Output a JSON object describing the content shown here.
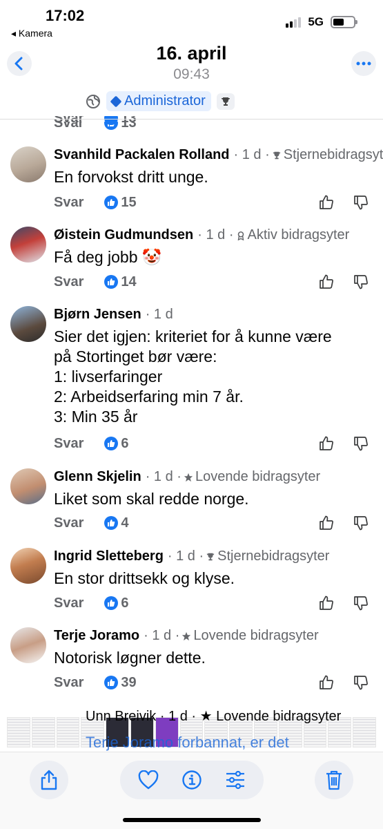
{
  "status_bar": {
    "time": "17:02",
    "back_app": "◂ Kamera",
    "network": "5G"
  },
  "header": {
    "date": "16. april",
    "time": "09:43"
  },
  "badges": {
    "admin_label": "Administrator"
  },
  "top_partial": {
    "reply": "Svar",
    "likes": "13"
  },
  "comments": [
    {
      "name": "Svanhild Packalen Rolland",
      "age": "· 1 d ·",
      "badge": "Stjernebidragsyter",
      "text": "En forvokst dritt unge.",
      "reply": "Svar",
      "likes": "15"
    },
    {
      "name": "Øistein Gudmundsen",
      "age": "· 1 d ·",
      "badge": "Aktiv bidragsyter",
      "text": "Få deg jobb 🤡",
      "reply": "Svar",
      "likes": "14"
    },
    {
      "name": "Bjørn Jensen",
      "age": "· 1 d",
      "badge": "",
      "text_lines": [
        "Sier det igjen: kriteriet for å kunne være",
        "på Stortinget bør være:",
        "1: livserfaringer",
        "2: Arbeidserfaring min 7 år.",
        "3: Min 35 år"
      ],
      "reply": "Svar",
      "likes": "6"
    },
    {
      "name": "Glenn Skjelin",
      "age": "· 1 d ·",
      "badge": "Lovende bidragsyter",
      "text": "Liket som skal redde norge.",
      "reply": "Svar",
      "likes": "4"
    },
    {
      "name": "Ingrid Sletteberg",
      "age": "· 1 d ·",
      "badge": "Stjernebidragsyter",
      "text": "En stor drittsekk og klyse.",
      "reply": "Svar",
      "likes": "6"
    },
    {
      "name": "Terje Joramo",
      "age": "· 1 d ·",
      "badge": "Lovende bidragsyter",
      "text": "Notorisk løgner dette.",
      "reply": "Svar",
      "likes": "39"
    }
  ],
  "bottom_partial": {
    "header": "Unn Breivik · 1 d · ★ Lovende bidragsyter",
    "text": "Terje Joramo forbannat, er det"
  },
  "colors": {
    "accent": "#1877f2",
    "meta": "#65676b",
    "admin_bg": "#e7f0fe",
    "admin_text": "#1b66d8"
  }
}
